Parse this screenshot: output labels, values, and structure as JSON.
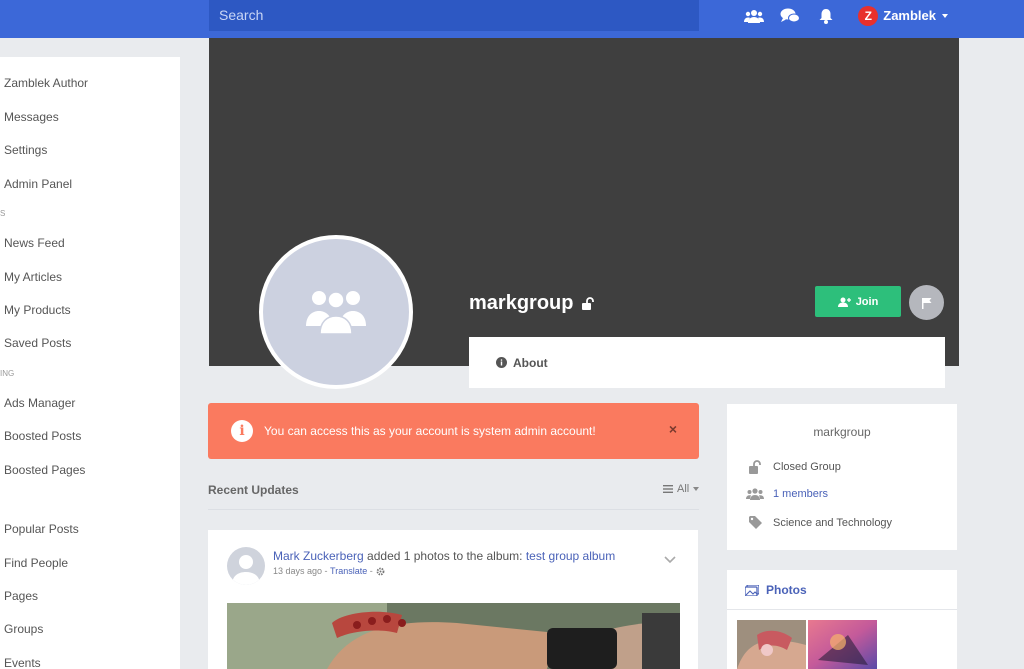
{
  "topbar": {
    "search_placeholder": "Search",
    "user_initial": "Z",
    "user_name": "Zamblek"
  },
  "sidebar": {
    "items": [
      {
        "label": "Zamblek Author"
      },
      {
        "label": "Messages"
      },
      {
        "label": "Settings"
      },
      {
        "label": "Admin Panel"
      },
      {
        "label": "News Feed"
      },
      {
        "label": "My Articles"
      },
      {
        "label": "My Products"
      },
      {
        "label": "Saved Posts"
      },
      {
        "label": "Ads Manager"
      },
      {
        "label": "Boosted Posts"
      },
      {
        "label": "Boosted Pages"
      },
      {
        "label": "Popular Posts"
      },
      {
        "label": "Find People"
      },
      {
        "label": "Pages"
      },
      {
        "label": "Groups"
      },
      {
        "label": "Events"
      }
    ],
    "headers": [
      "S",
      "ING"
    ]
  },
  "group": {
    "name": "markgroup",
    "join_label": "Join",
    "about_label": "About"
  },
  "alert": {
    "message": "You can access this as your account is system admin account!",
    "icon_text": "i",
    "close": "×"
  },
  "feed": {
    "section_title": "Recent Updates",
    "filter_label": "All"
  },
  "post": {
    "author": "Mark Zuckerberg",
    "action": "added 1 photos to the album:",
    "album": "test group album",
    "time": "13 days ago",
    "sep": " - ",
    "translate": "Translate",
    "trail": " -"
  },
  "info_panel": {
    "title": "markgroup",
    "privacy": "Closed Group",
    "members": "1 members",
    "category": "Science and Technology"
  },
  "photos_panel": {
    "title": "Photos"
  },
  "colors": {
    "topbar": "#3c68d8",
    "join": "#2dbf7b",
    "alert": "#fa7a5f",
    "link": "#4a62b8"
  }
}
